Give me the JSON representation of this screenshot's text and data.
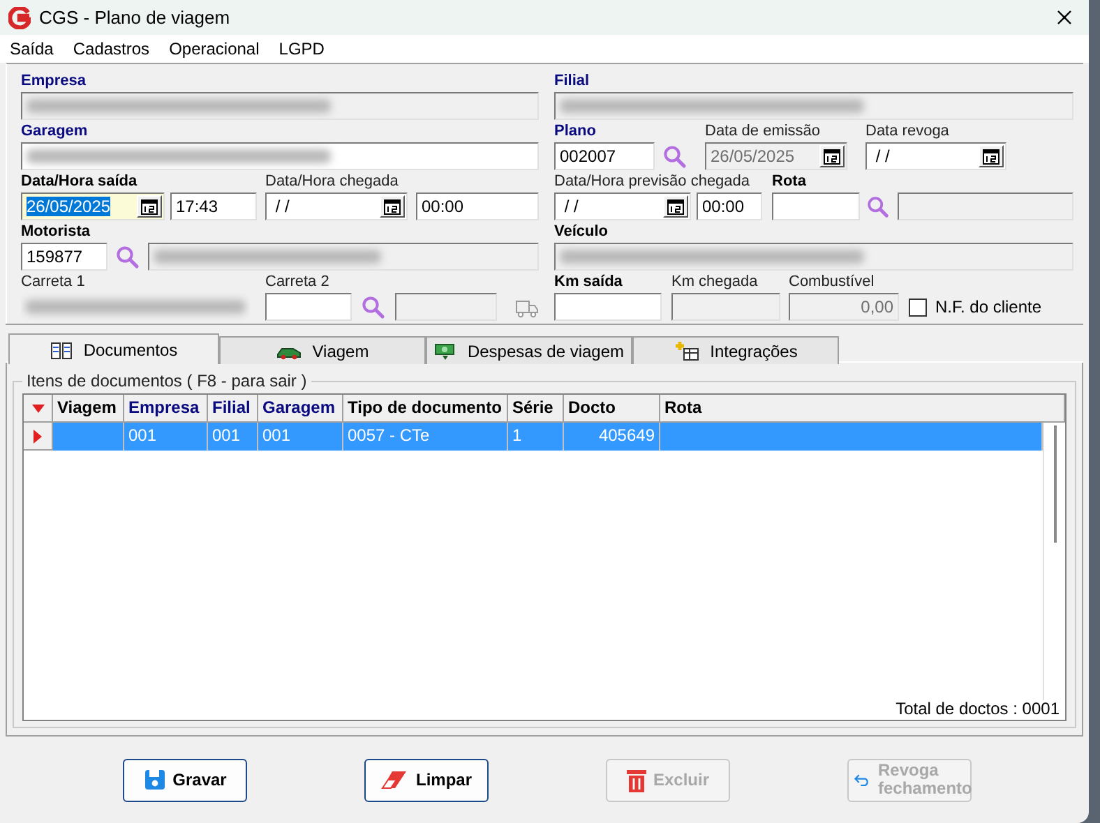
{
  "window": {
    "title": "CGS - Plano de viagem"
  },
  "menu": [
    "Saída",
    "Cadastros",
    "Operacional",
    "LGPD"
  ],
  "form_rows": [
    {
      "left": [
        {
          "label": "Empresa",
          "bold": true,
          "key": true,
          "controls": [
            {
              "kind": "input",
              "disabled": true,
              "blurred": true
            }
          ]
        }
      ],
      "right": [
        {
          "label": "Filial",
          "bold": true,
          "key": true,
          "controls": [
            {
              "kind": "input",
              "disabled": true,
              "blurred": true
            }
          ]
        }
      ]
    },
    {
      "left": [
        {
          "label": "Garagem",
          "bold": true,
          "key": true,
          "controls": [
            {
              "kind": "input",
              "disabled": false,
              "blurred": true
            }
          ]
        }
      ],
      "right": [
        {
          "label": "Plano",
          "bold": true,
          "key": true,
          "controls": [
            {
              "kind": "input",
              "value": "002007",
              "disabled": false
            },
            {
              "kind": "search"
            }
          ]
        },
        {
          "label": "Data de emissão",
          "bold": false,
          "key": false,
          "controls": [
            {
              "kind": "date",
              "value": "26/05/2025",
              "disabled": true
            }
          ]
        },
        {
          "label": "Data revoga",
          "bold": false,
          "key": false,
          "controls": [
            {
              "kind": "date",
              "value": " / /",
              "disabled": false
            }
          ]
        }
      ]
    },
    {
      "left": [
        {
          "label": "Data/Hora saída",
          "bold": true,
          "key": false,
          "controls": [
            {
              "kind": "date",
              "value": "26/05/2025",
              "disabled": false,
              "focused": true
            },
            {
              "kind": "input",
              "value": "17:43",
              "disabled": false
            }
          ]
        },
        {
          "label": "Data/Hora chegada",
          "bold": false,
          "key": false,
          "controls": [
            {
              "kind": "date",
              "value": " / /",
              "disabled": false
            },
            {
              "kind": "input",
              "value": "00:00",
              "disabled": false
            }
          ]
        }
      ],
      "right": [
        {
          "label": "Data/Hora previsão chegada",
          "bold": false,
          "key": false,
          "controls": [
            {
              "kind": "date",
              "value": " / /",
              "disabled": false
            },
            {
              "kind": "input",
              "value": "00:00",
              "disabled": false
            }
          ]
        },
        {
          "label": "Rota",
          "bold": true,
          "key": false,
          "controls": [
            {
              "kind": "input",
              "disabled": false
            },
            {
              "kind": "search"
            },
            {
              "kind": "input",
              "disabled": true
            }
          ]
        }
      ]
    },
    {
      "left": [
        {
          "label": "Motorista",
          "bold": true,
          "key": false,
          "controls": [
            {
              "kind": "input",
              "value": "159877",
              "disabled": false
            },
            {
              "kind": "search"
            },
            {
              "kind": "input",
              "disabled": true,
              "blurred": true
            }
          ]
        }
      ],
      "right": [
        {
          "label": "Veículo",
          "bold": true,
          "key": false,
          "controls": [
            {
              "kind": "input",
              "disabled": true,
              "blurred": true
            }
          ]
        }
      ]
    },
    {
      "left": [
        {
          "label": "Carreta 1",
          "bold": false,
          "key": false,
          "controls": [
            {
              "kind": "blurred"
            }
          ]
        },
        {
          "label": "Carreta 2",
          "bold": false,
          "key": false,
          "controls": [
            {
              "kind": "input",
              "disabled": false
            },
            {
              "kind": "search"
            },
            {
              "kind": "input",
              "disabled": true
            },
            {
              "kind": "truck"
            }
          ]
        }
      ],
      "right": [
        {
          "label": "Km saída",
          "bold": true,
          "key": false,
          "controls": [
            {
              "kind": "input",
              "disabled": false
            }
          ]
        },
        {
          "label": "Km chegada",
          "bold": false,
          "key": false,
          "controls": [
            {
              "kind": "input",
              "disabled": true
            }
          ]
        },
        {
          "label": "Combustível",
          "bold": false,
          "key": false,
          "controls": [
            {
              "kind": "number",
              "value": "0,00",
              "disabled": true
            }
          ]
        },
        {
          "controls": [
            {
              "kind": "checkbox",
              "label": "N.F. do cliente",
              "checked": false
            }
          ]
        }
      ]
    }
  ],
  "tabs": [
    {
      "label": "Documentos",
      "selected": true
    },
    {
      "label": "Viagem",
      "selected": false
    },
    {
      "label": "Despesas de viagem",
      "selected": false
    },
    {
      "label": "Integrações",
      "selected": false
    }
  ],
  "group_title": "Itens de documentos ( F8 - para sair )",
  "table": {
    "columns": [
      {
        "label": "Viagem",
        "key": false
      },
      {
        "label": "Empresa",
        "key": true
      },
      {
        "label": "Filial",
        "key": true
      },
      {
        "label": "Garagem",
        "key": true
      },
      {
        "label": "Tipo de documento",
        "key": false
      },
      {
        "label": "Série",
        "key": false
      },
      {
        "label": "Docto",
        "key": false
      },
      {
        "label": "Rota",
        "key": false
      }
    ],
    "rows": [
      {
        "selected": true,
        "cells": [
          "",
          "001",
          "001",
          "001",
          "0057 - CTe",
          "1",
          "405649",
          ""
        ]
      }
    ]
  },
  "total": "Total de doctos : 0001",
  "buttons": [
    {
      "label": "Gravar",
      "disabled": false
    },
    {
      "label": "Limpar",
      "disabled": false
    },
    {
      "label": "Excluir",
      "disabled": true
    },
    {
      "label": "Revoga fechamento",
      "disabled": true
    }
  ]
}
